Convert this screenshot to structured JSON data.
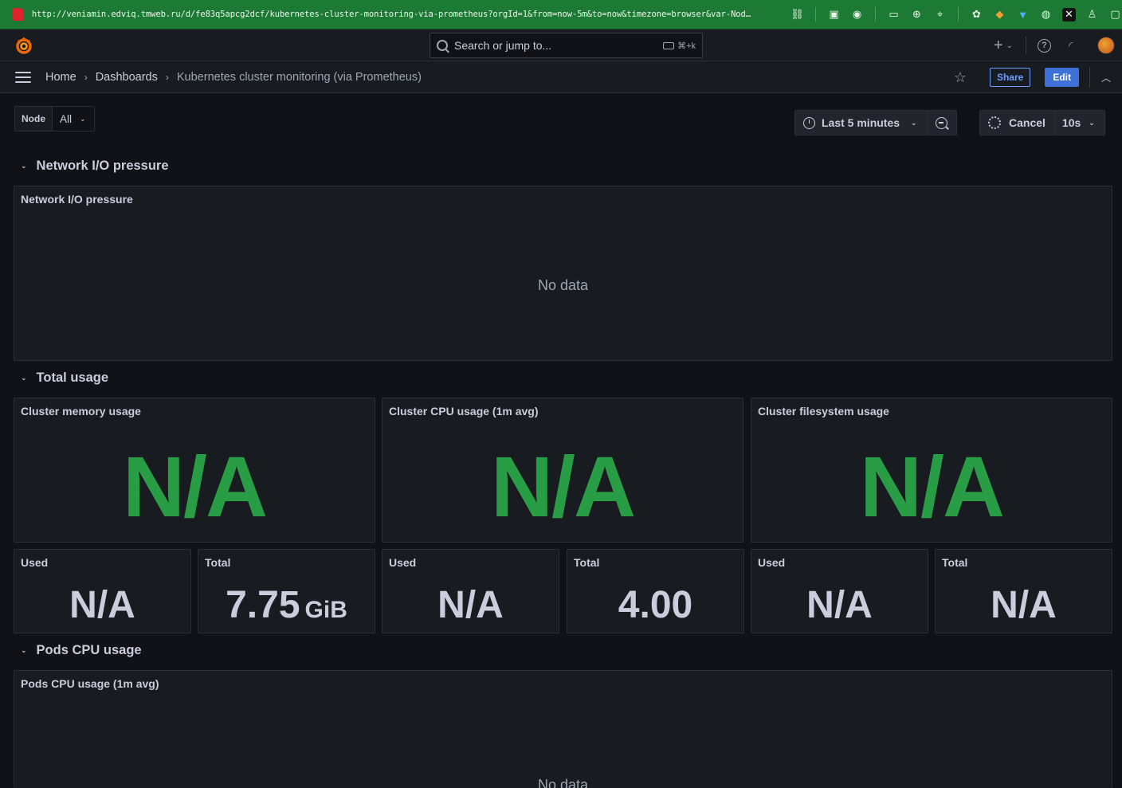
{
  "browser": {
    "url": "http://veniamin.edviq.tmweb.ru/d/fe83q5apcg2dcf/kubernetes-cluster-monitoring-via-prometheus?orgId=1&from=now-5m&to=now&timezone=browser&var-Nod…",
    "extension_icons": [
      "link-icon",
      "screenshot-icon",
      "camera-icon",
      "terminal-icon",
      "globe-icon",
      "crosshair-icon",
      "extension-icon",
      "fox-icon",
      "shield-icon",
      "vpn-icon",
      "x-icon",
      "user-icon",
      "sidebar-icon"
    ]
  },
  "topnav": {
    "search_placeholder": "Search or jump to...",
    "search_shortcut": "⌘+k",
    "plus_label": "+"
  },
  "breadcrumb": {
    "items": [
      "Home",
      "Dashboards",
      "Kubernetes cluster monitoring (via Prometheus)"
    ],
    "share_label": "Share",
    "edit_label": "Edit"
  },
  "variables": {
    "node_label": "Node",
    "node_value": "All"
  },
  "time": {
    "range_label": "Last 5 minutes",
    "cancel_label": "Cancel",
    "refresh_interval": "10s"
  },
  "rows": [
    {
      "title": "Network I/O pressure",
      "panels": [
        {
          "title": "Network I/O pressure",
          "content": "No data"
        }
      ]
    },
    {
      "title": "Total usage",
      "panels": [
        {
          "title": "Cluster memory usage",
          "value": "N/A"
        },
        {
          "title": "Cluster CPU usage (1m avg)",
          "value": "N/A"
        },
        {
          "title": "Cluster filesystem usage",
          "value": "N/A"
        }
      ],
      "small_panels": [
        {
          "title": "Used",
          "value": "N/A",
          "unit": ""
        },
        {
          "title": "Total",
          "value": "7.75",
          "unit": "GiB"
        },
        {
          "title": "Used",
          "value": "N/A",
          "unit": ""
        },
        {
          "title": "Total",
          "value": "4.00",
          "unit": ""
        },
        {
          "title": "Used",
          "value": "N/A",
          "unit": ""
        },
        {
          "title": "Total",
          "value": "N/A",
          "unit": ""
        }
      ]
    },
    {
      "title": "Pods CPU usage",
      "panels": [
        {
          "title": "Pods CPU usage (1m avg)",
          "content": "No data"
        }
      ]
    }
  ],
  "colors": {
    "stat_green": "#299c46",
    "accent_blue": "#3d71d9",
    "browser_bar": "#1d7a34"
  }
}
